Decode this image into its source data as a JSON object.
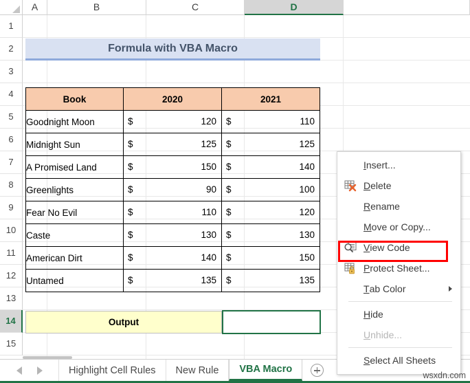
{
  "spreadsheet": {
    "column_headers": [
      "A",
      "B",
      "C",
      "D"
    ],
    "active_column": "D",
    "row_headers": [
      "1",
      "2",
      "3",
      "4",
      "5",
      "6",
      "7",
      "8",
      "9",
      "10",
      "11",
      "12",
      "13",
      "14",
      "15"
    ],
    "active_row": "14",
    "title_banner": "Formula with VBA Macro",
    "table": {
      "headers": [
        "Book",
        "2020",
        "2021"
      ],
      "currency_symbol": "$",
      "rows": [
        {
          "book": "Goodnight Moon",
          "y2020": "120",
          "y2021": "110"
        },
        {
          "book": "Midnight Sun",
          "y2020": "125",
          "y2021": "125"
        },
        {
          "book": "A Promised Land",
          "y2020": "150",
          "y2021": "140"
        },
        {
          "book": "Greenlights",
          "y2020": "90",
          "y2021": "100"
        },
        {
          "book": "Fear No Evil",
          "y2020": "110",
          "y2021": "120"
        },
        {
          "book": "Caste",
          "y2020": "130",
          "y2021": "130"
        },
        {
          "book": "American Dirt",
          "y2020": "140",
          "y2021": "150"
        },
        {
          "book": "Untamed",
          "y2020": "135",
          "y2021": "135"
        }
      ]
    },
    "output_label": "Output",
    "selected_cell_value": ""
  },
  "context_menu": {
    "items": [
      {
        "label": "Insert...",
        "accel": "I",
        "icon": "none",
        "disabled": false,
        "submenu": false
      },
      {
        "label": "Delete",
        "accel": "D",
        "icon": "delete-sheet",
        "disabled": false,
        "submenu": false
      },
      {
        "label": "Rename",
        "accel": "R",
        "icon": "none",
        "disabled": false,
        "submenu": false
      },
      {
        "label": "Move or Copy...",
        "accel": "M",
        "icon": "none",
        "disabled": false,
        "submenu": false
      },
      {
        "label": "View Code",
        "accel": "V",
        "icon": "view-code",
        "disabled": false,
        "submenu": false
      },
      {
        "label": "Protect Sheet...",
        "accel": "P",
        "icon": "protect-sheet",
        "disabled": false,
        "submenu": false
      },
      {
        "label": "Tab Color",
        "accel": "T",
        "icon": "none",
        "disabled": false,
        "submenu": true
      },
      {
        "label": "Hide",
        "accel": "H",
        "icon": "none",
        "disabled": false,
        "submenu": false
      },
      {
        "label": "Unhide...",
        "accel": "U",
        "icon": "none",
        "disabled": true,
        "submenu": false
      },
      {
        "label": "Select All Sheets",
        "accel": "S",
        "icon": "none",
        "disabled": false,
        "submenu": false
      }
    ],
    "highlighted_item": "View Code",
    "highlight_color": "#ff0000"
  },
  "sheet_tabs": {
    "tabs": [
      {
        "label": "Highlight Cell Rules",
        "active": false
      },
      {
        "label": "New Rule",
        "active": false
      },
      {
        "label": "VBA Macro",
        "active": true
      }
    ],
    "add_sheet_label": "+"
  },
  "watermark": "wsxdn.com",
  "colors": {
    "excel_green": "#217346",
    "title_banner_bg": "#d9e1f2",
    "table_header_bg": "#f8cbad",
    "output_bg": "#ffffcc",
    "highlight_red": "#ff0000"
  }
}
